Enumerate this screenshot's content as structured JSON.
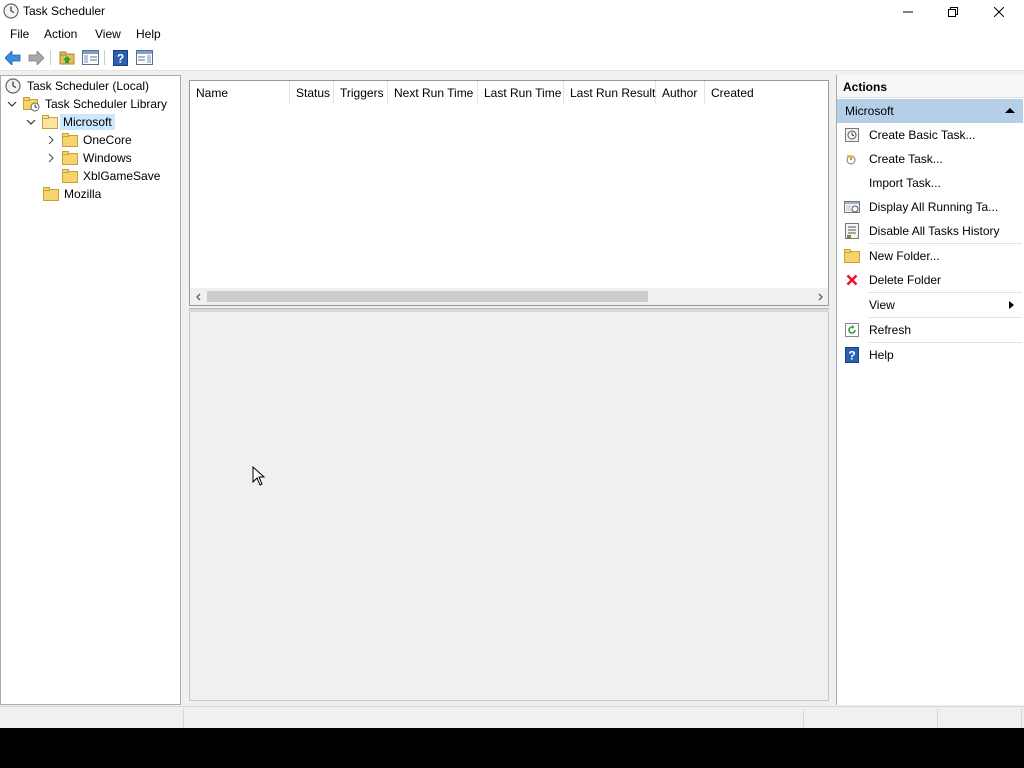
{
  "window": {
    "title": "Task Scheduler"
  },
  "menu": [
    "File",
    "Action",
    "View",
    "Help"
  ],
  "toolbar": {
    "buttons": [
      "back-icon",
      "forward-icon",
      "up-folder-icon",
      "show-hide-console-tree-icon",
      "help-icon",
      "show-hide-action-pane-icon"
    ]
  },
  "tree": {
    "root": "Task Scheduler (Local)",
    "library": "Task Scheduler Library",
    "microsoft": "Microsoft",
    "onecore": "OneCore",
    "windows": "Windows",
    "xblgamesave": "XblGameSave",
    "mozilla": "Mozilla"
  },
  "task_list": {
    "columns": [
      "Name",
      "Status",
      "Triggers",
      "Next Run Time",
      "Last Run Time",
      "Last Run Result",
      "Author",
      "Created"
    ]
  },
  "actions": {
    "header": "Actions",
    "section": "Microsoft",
    "items": [
      {
        "label": "Create Basic Task...",
        "icon": "create-basic-task-icon"
      },
      {
        "label": "Create Task...",
        "icon": "create-task-icon"
      },
      {
        "label": "Import Task...",
        "icon": ""
      },
      {
        "label": "Display All Running Ta...",
        "icon": "running-tasks-icon"
      },
      {
        "label": "Disable All Tasks History",
        "icon": "tasks-history-icon"
      },
      {
        "label": "New Folder...",
        "icon": "new-folder-icon"
      },
      {
        "label": "Delete Folder",
        "icon": "delete-icon"
      },
      {
        "label": "View",
        "icon": ""
      },
      {
        "label": "Refresh",
        "icon": "refresh-icon"
      },
      {
        "label": "Help",
        "icon": "help-icon"
      }
    ]
  },
  "colors": {
    "selection": "#cce8ff",
    "section_header": "#b5cfe9",
    "folder": "#f6d36b",
    "delete_red": "#e81123",
    "help_blue": "#2b5fb4"
  }
}
